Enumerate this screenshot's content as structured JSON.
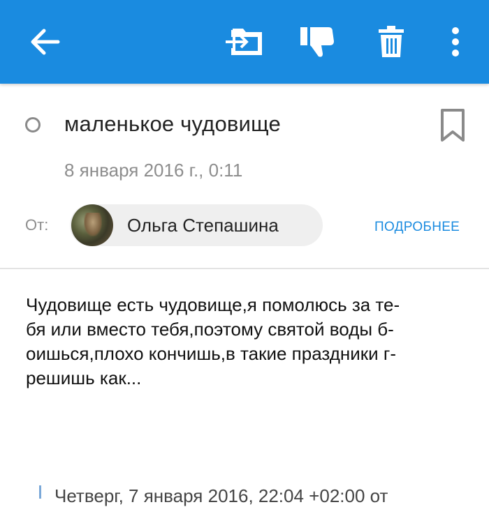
{
  "appbar": {
    "color": "#1a8be0",
    "back_icon": "arrow-left-icon",
    "move_icon": "move-to-folder-icon",
    "spam_icon": "thumbs-down-icon",
    "delete_icon": "trash-icon",
    "menu_icon": "more-vertical-icon"
  },
  "message": {
    "subject": "маленькое чудовище",
    "date": "8 января 2016 г., 0:11",
    "from_label": "От:",
    "sender_name": "Ольга Степашина",
    "details_link": "ПОДРОБНЕЕ",
    "body_lines": [
      "Чудовище есть чудовище,я помолюсь за те-",
      "бя или вместо тебя,поэтому святой воды б-",
      "оишься,плохо кончишь,в такие праздники г-",
      "решишь как..."
    ],
    "quote_header": "Четверг, 7 января 2016, 22:04 +02:00 от"
  }
}
